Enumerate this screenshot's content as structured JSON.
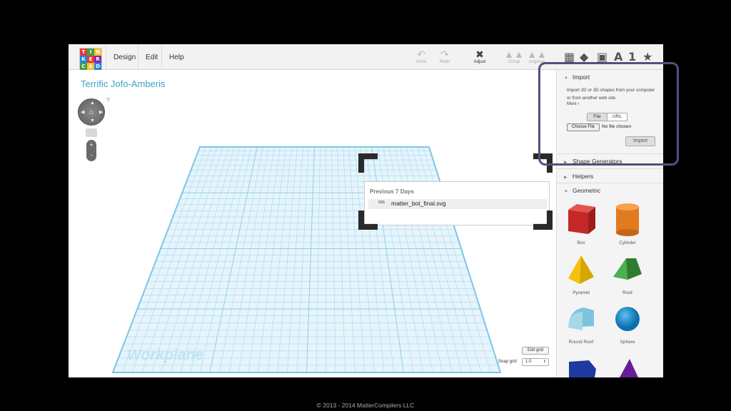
{
  "app": {
    "logo_letters": [
      "T",
      "I",
      "N",
      "K",
      "E",
      "R",
      "C",
      "A",
      "D"
    ],
    "logo_colors": [
      "#e53935",
      "#43a047",
      "#fbc02d",
      "#1e88e5",
      "#e53935",
      "#8e24aa",
      "#43a047",
      "#fbc02d",
      "#1e88e5"
    ]
  },
  "menu": {
    "design": "Design",
    "edit": "Edit",
    "help": "Help"
  },
  "toolbar": {
    "undo": "Undo",
    "redo": "Redo",
    "adjust": "Adjust",
    "group": "Group",
    "ungroup": "Ungroup",
    "view_text": "A",
    "view_num": "1"
  },
  "design_title": "Terrific Jofo-Amberis",
  "help_q": "?",
  "zoom": {
    "plus": "+",
    "minus": "-"
  },
  "workplane": {
    "label": "Workplane"
  },
  "grid": {
    "edit_label": "Edit grid",
    "snap_label": "Snap grid",
    "snap_value": "1.0",
    "snap_arrow": "⇕"
  },
  "popup": {
    "heading": "Previous 7 Days",
    "file_icon": "SVG",
    "file_name": "matter_bot_final.svg"
  },
  "panel": {
    "import": {
      "title": "Import",
      "description": "Import 2D or 3D shapes from your computer or from another web site.",
      "more": "More ›",
      "tabs": [
        "File",
        "URL"
      ],
      "choose_label": "Choose File",
      "no_file": "No file chosen",
      "import_button": "Import"
    },
    "sections": {
      "shape_generators": "Shape Generators",
      "helpers": "Helpers",
      "geometric": "Geometric"
    },
    "shapes": [
      "Box",
      "Cylinder",
      "Pyramid",
      "Roof",
      "Round Roof",
      "Sphere"
    ]
  },
  "colors": {
    "accent_title": "#3ba3c7",
    "highlight": "#5c4b7c",
    "grid": "#7cc6e8"
  },
  "footer": "© 2013 - 2014 MatterCompilers LLC"
}
